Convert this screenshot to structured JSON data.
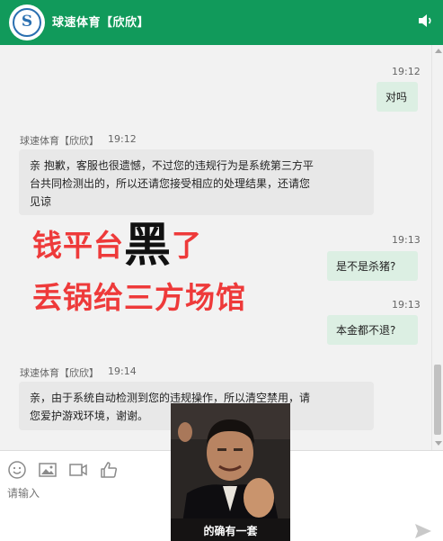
{
  "header": {
    "title": "球速体育【欣欣】",
    "logo_text": "S",
    "speaker_icon": "speaker-icon"
  },
  "messages": [
    {
      "side": "right",
      "time": "19:12",
      "text": "对吗"
    },
    {
      "side": "left",
      "sender": "球速体育【欣欣】",
      "time": "19:12",
      "lines": [
        "亲 抱歉，客服也很遗憾，不过您的违规行为是系统第三方平",
        "台共同检测出的，所以还请您接受相应的处理结果，还请您",
        "见谅"
      ]
    },
    {
      "side": "right",
      "time": "19:13",
      "text": "是不是杀猪?"
    },
    {
      "side": "right",
      "time": "19:13",
      "text": "本金都不退?"
    },
    {
      "side": "left",
      "sender": "球速体育【欣欣】",
      "time": "19:14",
      "lines": [
        "亲，由于系统自动检测到您的违规操作，所以清空禁用，请",
        "您爱护游戏环境，谢谢。"
      ]
    }
  ],
  "overlay": {
    "line1_a": "钱平台",
    "line1_b": "黑",
    "line1_c": "了",
    "line2": "丢锅给三方场馆",
    "color": "#ee3a3a"
  },
  "meme": {
    "caption": "的确有一套"
  },
  "toolbar": {
    "icons": [
      "emoji-icon",
      "image-icon",
      "video-icon",
      "thumbs-up-icon"
    ],
    "input_placeholder": "请输入",
    "send_icon": "send-icon"
  },
  "colors": {
    "header": "#119a5b",
    "bubble_right": "#dcefe3",
    "bubble_left": "#e8e8e8",
    "chat_bg": "#f2f2f2"
  }
}
